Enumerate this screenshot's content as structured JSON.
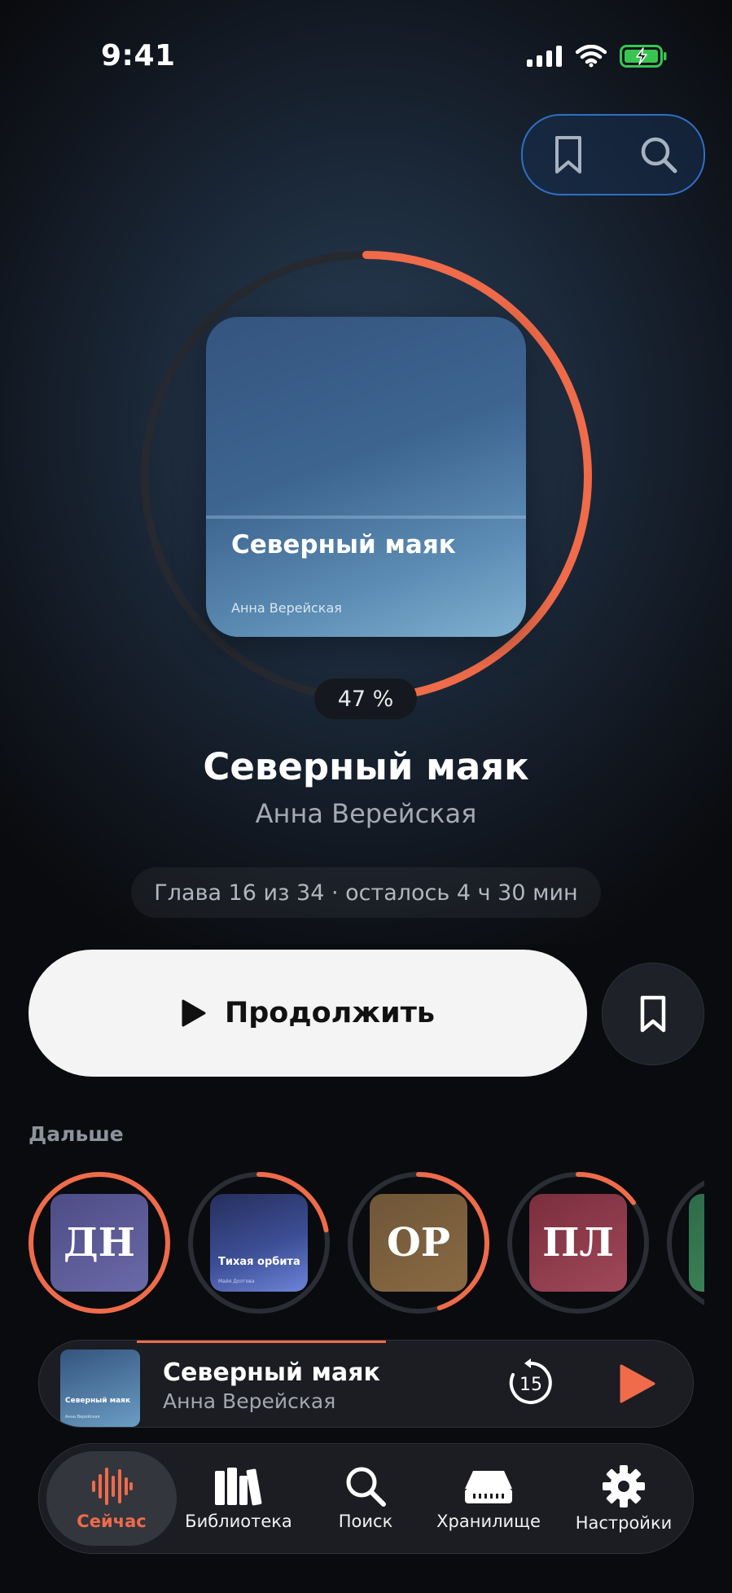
{
  "status_bar": {
    "time": "9:41"
  },
  "colors": {
    "accent": "#ef6b4a",
    "ring_track": "#2b2e34"
  },
  "top_actions": {
    "bookmark_icon": "bookmark-icon",
    "search_icon": "search-icon"
  },
  "now_playing": {
    "cover_title": "Северный маяк",
    "cover_author": "Анна Верейская",
    "progress_percent": 47,
    "progress_label": "47 %",
    "title": "Северный маяк",
    "author": "Анна Верейская",
    "chapter_info": "Глава 16 из 34 · осталось 4 ч 30 мин",
    "continue_label": "Продолжить"
  },
  "queue": {
    "label": "Дальше",
    "items": [
      {
        "initials": "ДН",
        "progress": 1.0
      },
      {
        "title": "Тихая орбита",
        "author": "Майя Долгова",
        "progress": 0.22
      },
      {
        "initials": "ОР",
        "progress": 0.45
      },
      {
        "initials": "ПЛ",
        "progress": 0.15
      },
      {
        "initials": "",
        "progress": 0.0
      }
    ]
  },
  "mini_player": {
    "title": "Северный маяк",
    "author": "Анна Верейская",
    "cover_title": "Северный маяк",
    "cover_author": "Анна Верейская",
    "skip_label": "15",
    "progress": 0.38
  },
  "tabs": [
    {
      "label": "Сейчас",
      "icon": "waveform-icon",
      "active": true
    },
    {
      "label": "Библиотека",
      "icon": "books-icon",
      "active": false
    },
    {
      "label": "Поиск",
      "icon": "search-icon",
      "active": false
    },
    {
      "label": "Хранилище",
      "icon": "storage-icon",
      "active": false
    },
    {
      "label": "Настройки",
      "icon": "gear-icon",
      "active": false
    }
  ]
}
